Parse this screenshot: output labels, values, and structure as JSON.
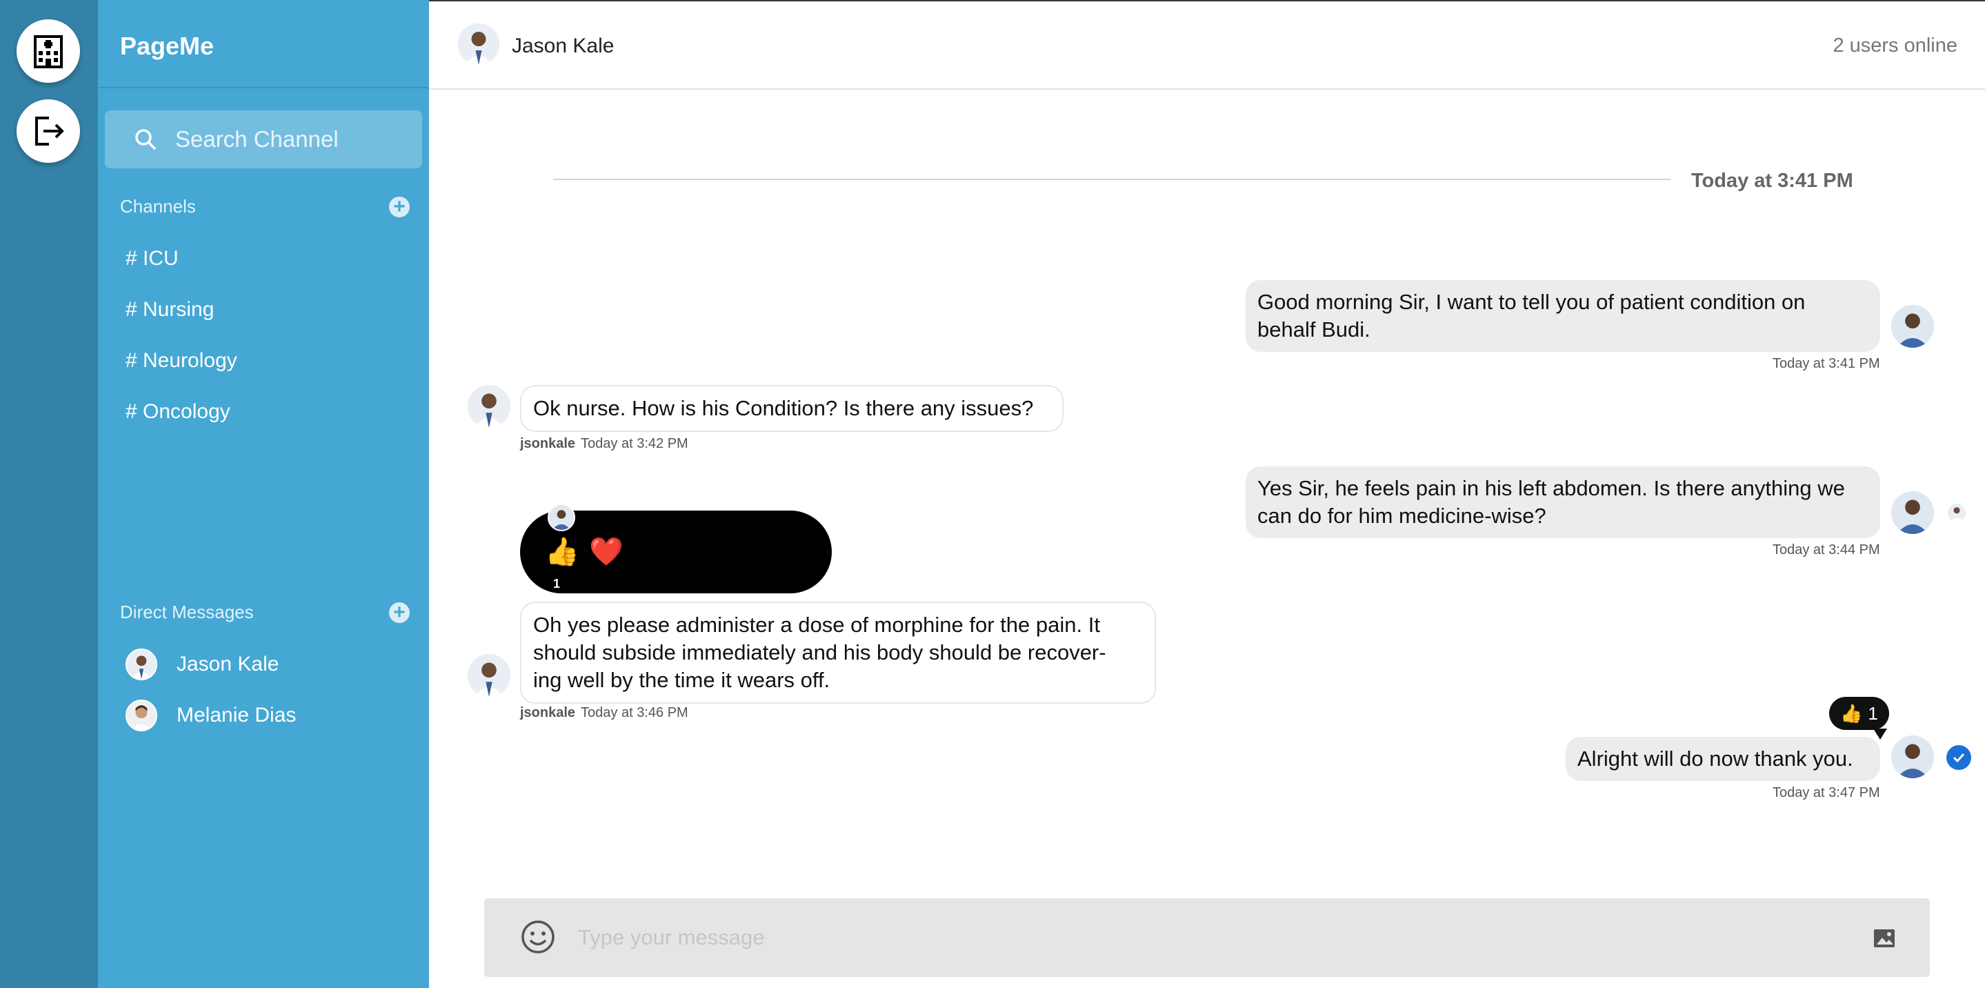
{
  "rail": {
    "items": [
      {
        "icon": "hospital-icon"
      },
      {
        "icon": "logout-icon"
      }
    ]
  },
  "sidebar": {
    "brand": "PageMe",
    "search_placeholder": "Search Channel",
    "channels_title": "Channels",
    "channels": [
      "# ICU",
      "# Nursing",
      "# Neurology",
      "# Oncology"
    ],
    "dm_title": "Direct Messages",
    "direct_messages": [
      "Jason Kale",
      "Melanie Dias"
    ]
  },
  "header": {
    "name": "Jason Kale",
    "online": "2 users online"
  },
  "chat": {
    "date_separator": "Today at 3:41 PM",
    "messages": [
      {
        "line1": "Good morning Sir, I want to tell you of patient condition on",
        "line2": "behalf Budi.",
        "time": "Today at 3:41 PM"
      },
      {
        "text": "Ok nurse. How is his Condition? Is there any issues?",
        "user": "jsonkale",
        "time": "Today at 3:42 PM"
      },
      {
        "line1": "Yes Sir, he feels pain in his left abdomen. Is there anything we",
        "line2": "can do for him medicine-wise?",
        "time": "Today at 3:44 PM"
      },
      {
        "line1": "Oh yes please administer a dose of morphine for the pain. It",
        "line2": "should subside immediately and his body should be recover-",
        "line3": "ing well by the time it wears off.",
        "user": "jsonkale",
        "time": "Today at 3:46 PM"
      },
      {
        "text": "Alright will do now thank you.",
        "time": "Today at 3:47 PM"
      }
    ],
    "reactions": [
      {
        "emoji": "👍",
        "count": "1"
      },
      {
        "emoji": "❤️"
      },
      {
        "emoji": "😂"
      },
      {
        "emoji": "😲"
      },
      {
        "emoji": "😔"
      },
      {
        "emoji": "😠"
      }
    ],
    "reaction_pill": {
      "emoji": "👍",
      "count": "1"
    }
  },
  "composer": {
    "placeholder": "Type your message"
  },
  "colors": {
    "rail": "#3582a8",
    "sidebar": "#45a7d4",
    "bubble_me": "#ececec",
    "check": "#1b6fd8"
  }
}
